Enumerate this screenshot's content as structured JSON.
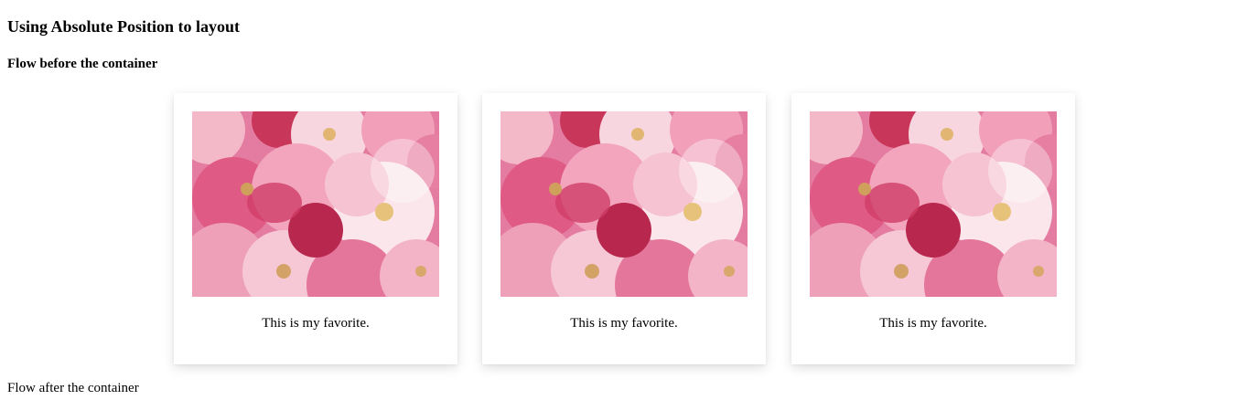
{
  "page": {
    "title": "Using Absolute Position to layout",
    "flow_before": "Flow before the container",
    "flow_after": "Flow after the container"
  },
  "cards": [
    {
      "caption": "This is my favorite.",
      "image": "pink-flower-photo"
    },
    {
      "caption": "This is my favorite.",
      "image": "pink-flower-photo"
    },
    {
      "caption": "This is my favorite.",
      "image": "pink-flower-photo"
    }
  ]
}
